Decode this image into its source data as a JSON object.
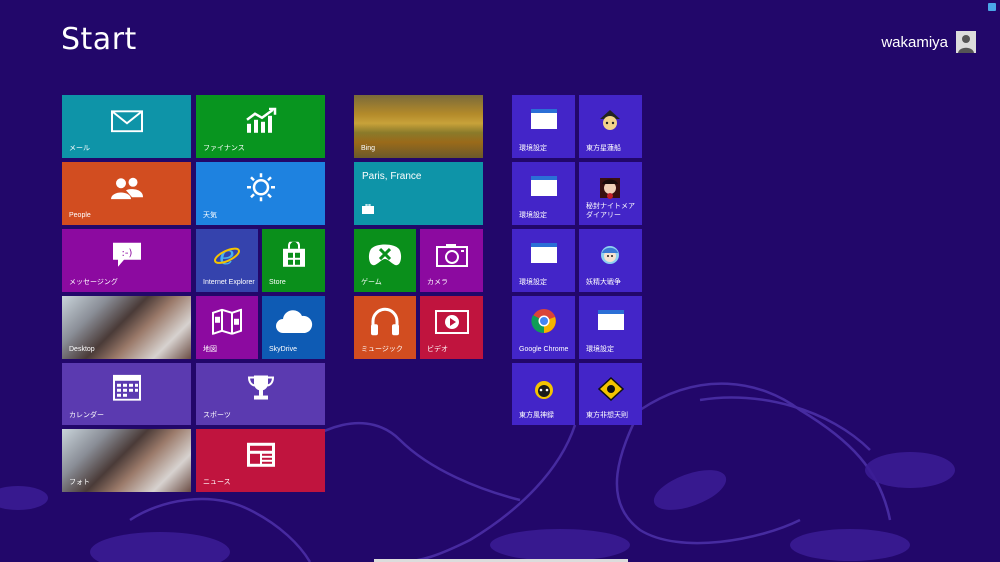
{
  "screen": {
    "title": "Start"
  },
  "user": {
    "name": "wakamiya"
  },
  "colors": {
    "background": "#22076a",
    "teal": "#0e94a8",
    "green": "#08951f",
    "orange": "#d24d20",
    "blue": "#1e82e0",
    "magenta": "#8c0aa0",
    "ie_blue": "#3543ad",
    "store_green": "#0a8f1b",
    "purple": "#5b3ab0",
    "crimson": "#c0143e",
    "dark_blue": "#0e5bb4",
    "desktop_app_tile": "#4325c8"
  },
  "group1": {
    "mail": "メール",
    "finance": "ファイナンス",
    "people": "People",
    "weather": "天気",
    "messaging": "メッセージング",
    "ie": "Internet Explorer",
    "store": "Store",
    "desktop": "Desktop",
    "maps": "地図",
    "skydrive": "SkyDrive",
    "calendar": "カレンダー",
    "sports": "スポーツ",
    "photos": "フォト",
    "news": "ニュース"
  },
  "group2": {
    "bing": "Bing",
    "travel": "Paris, France",
    "games": "ゲーム",
    "camera": "カメラ",
    "music": "ミュージック",
    "video": "ビデオ"
  },
  "group3": {
    "env1": "環境設定",
    "touhou_seireisen": "東方星蓮船",
    "env2": "環境設定",
    "touhou_zettai": "秘封ナイトメアダイアリー",
    "env3": "環境設定",
    "touhou_yousei": "妖精大戦争",
    "chrome": "Google Chrome",
    "env4": "環境設定",
    "touhou_fuujinroku": "東方風神録",
    "touhou_hisoutensoku": "東方非想天則"
  }
}
